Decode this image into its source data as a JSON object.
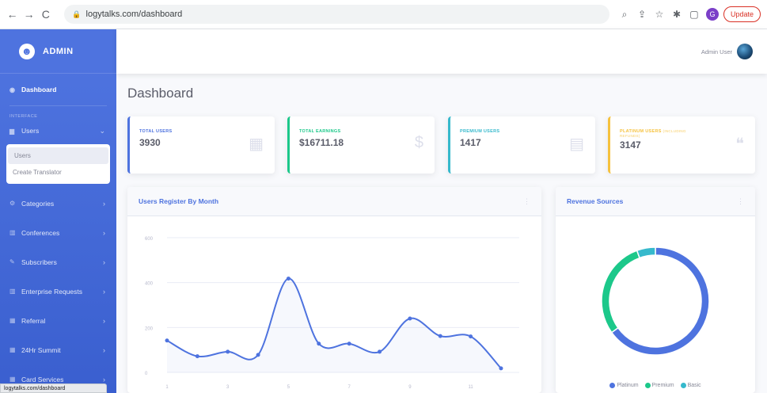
{
  "browser": {
    "url": "logytalks.com/dashboard",
    "update_label": "Update",
    "profile_initial": "G"
  },
  "sidebar": {
    "brand": "ADMIN",
    "dashboard": "Dashboard",
    "section_heading": "INTERFACE",
    "users": "Users",
    "users_sub": [
      "Users",
      "Create Translator"
    ],
    "items": [
      {
        "label": "Categories"
      },
      {
        "label": "Conferences"
      },
      {
        "label": "Subscribers"
      },
      {
        "label": "Enterprise Requests"
      },
      {
        "label": "Referral"
      },
      {
        "label": "24Hr Summit"
      },
      {
        "label": "Card Services"
      }
    ],
    "status_url": "logytalks.com/dashboard"
  },
  "topbar": {
    "user_name": "Admin User"
  },
  "main": {
    "page_title": "Dashboard"
  },
  "cards": [
    {
      "label": "TOTAL USERS",
      "value": "3930",
      "accent": "#4e73df",
      "label_color": "#4e73df",
      "icon": "calendar-icon"
    },
    {
      "label": "TOTAL EARNINGS",
      "value": "$16711.18",
      "accent": "#1cc88a",
      "label_color": "#1cc88a",
      "icon": "dollar-icon"
    },
    {
      "label": "PREMIUM USERS",
      "value": "1417",
      "accent": "#36b9cc",
      "label_color": "#36b9cc",
      "icon": "clipboard-icon"
    },
    {
      "label": "PLATINUM USERS",
      "label_suffix": "(INCLUDING",
      "label_line2": "REFUNDS)",
      "value": "3147",
      "accent": "#f6c23e",
      "label_color": "#f6c23e",
      "icon": "comments-icon"
    }
  ],
  "line_panel": {
    "title": "Users Register By Month"
  },
  "pie_panel": {
    "title": "Revenue Sources",
    "legend": [
      "Platinum",
      "Premium",
      "Basic"
    ]
  },
  "chart_data": [
    {
      "type": "area",
      "title": "Users Register By Month",
      "x": [
        1,
        2,
        3,
        4,
        5,
        6,
        7,
        8,
        9,
        10,
        11,
        12
      ],
      "x_tick_labels": [
        "1",
        "3",
        "5",
        "7",
        "9",
        "11"
      ],
      "x_tick_values": [
        1,
        3,
        5,
        7,
        9,
        11
      ],
      "y_ticks": [
        0,
        200,
        400,
        600
      ],
      "ylim": [
        0,
        600
      ],
      "series": [
        {
          "values": [
            142,
            72,
            92,
            78,
            418,
            128,
            128,
            92,
            240,
            162,
            160,
            18
          ],
          "color": "#4e73df"
        }
      ],
      "grid": true
    },
    {
      "type": "pie",
      "title": "Revenue Sources",
      "categories": [
        "Platinum",
        "Premium",
        "Basic"
      ],
      "values": [
        3147,
        1417,
        270
      ],
      "colors": [
        "#4e73df",
        "#1cc88a",
        "#36b9cc"
      ],
      "donut": true,
      "legend": "bottom"
    }
  ]
}
